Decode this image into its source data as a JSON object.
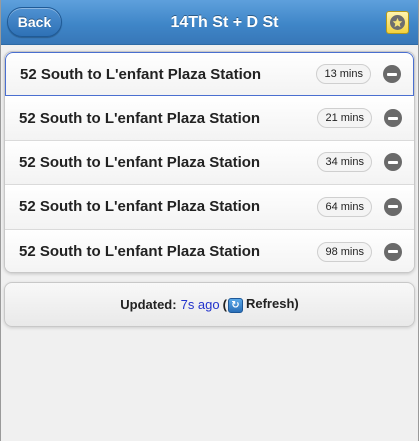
{
  "header": {
    "back_label": "Back",
    "title": "14Th St + D St"
  },
  "arrivals": [
    {
      "route": "52 South to L'enfant Plaza Station",
      "eta": "13 mins"
    },
    {
      "route": "52 South to L'enfant Plaza Station",
      "eta": "21 mins"
    },
    {
      "route": "52 South to L'enfant Plaza Station",
      "eta": "34 mins"
    },
    {
      "route": "52 South to L'enfant Plaza Station",
      "eta": "64 mins"
    },
    {
      "route": "52 South to L'enfant Plaza Station",
      "eta": "98 mins"
    }
  ],
  "footer": {
    "updated_label": "Updated:",
    "ago": "7s ago",
    "open_paren": "(",
    "refresh_label": "Refresh)"
  },
  "colors": {
    "header": "#3f86c8",
    "link": "#2233cc",
    "favorite": "#f2d23e"
  }
}
